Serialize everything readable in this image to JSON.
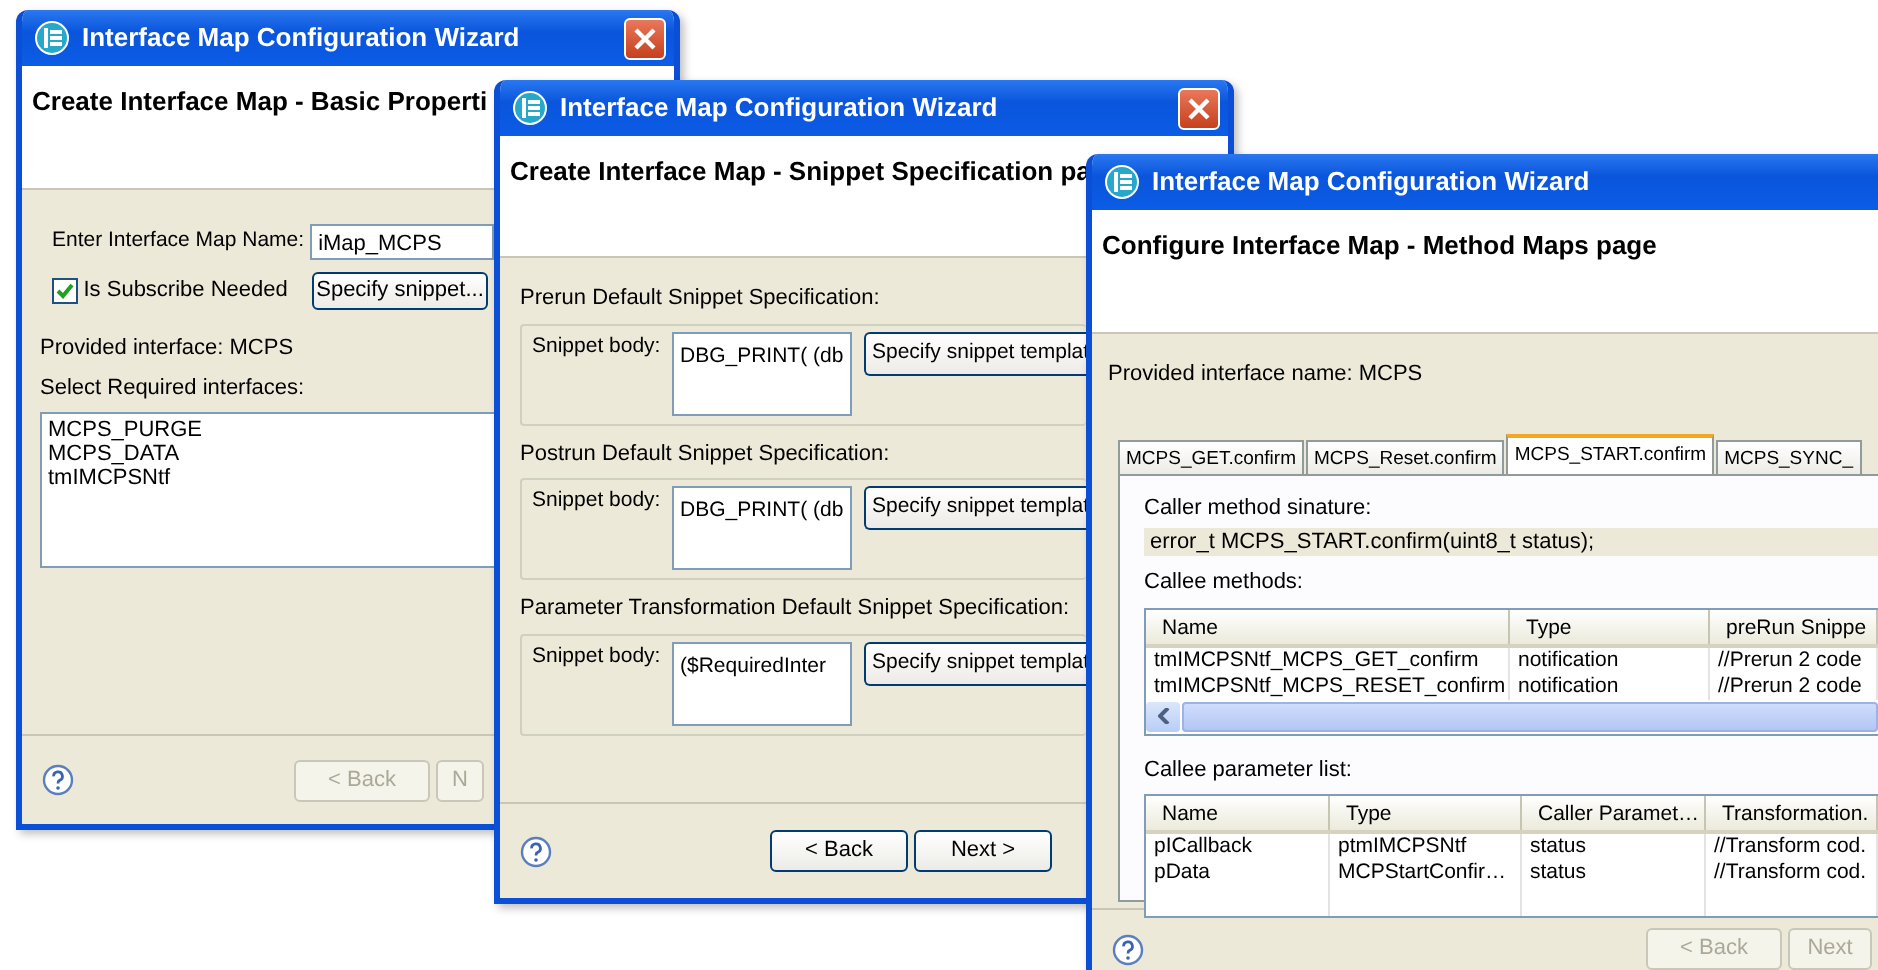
{
  "windows": [
    {
      "kind": "basic",
      "title": "Interface Map Configuration Wizard",
      "heading": "Create Interface Map - Basic Properti",
      "name_label": "Enter Interface Map Name:",
      "name_value": "iMap_MCPS",
      "subscribe": {
        "label": "Is Subscribe Needed",
        "checked": true
      },
      "snippet_button": "Specify snippet...",
      "provided": "Provided interface: MCPS",
      "select_label": "Select Required interfaces:",
      "interfaces": [
        "MCPS_PURGE",
        "MCPS_DATA",
        "tmIMCPSNtf"
      ],
      "buttons": [
        {
          "label": "< Back",
          "disabled": true
        },
        {
          "label": "N",
          "disabled": true
        }
      ]
    },
    {
      "kind": "snippet",
      "title": "Interface Map Configuration Wizard",
      "heading": "Create Interface Map - Snippet Specification pa",
      "groups": [
        {
          "label": "Prerun Default Snippet Specification:",
          "body_label": "Snippet body:",
          "body": "DBG_PRINT( (db",
          "button": "Specify snippet templat"
        },
        {
          "label": "Postrun Default Snippet Specification:",
          "body_label": "Snippet body:",
          "body": "DBG_PRINT( (db",
          "button": "Specify snippet templat"
        },
        {
          "label": "Parameter Transformation Default Snippet Specification:",
          "body_label": "Snippet body:",
          "body": "($RequiredInter",
          "button": "Specify snippet templat"
        }
      ],
      "buttons": [
        {
          "label": "< Back",
          "disabled": false
        },
        {
          "label": "Next >",
          "disabled": false
        }
      ]
    },
    {
      "kind": "methods",
      "title": "Interface Map Configuration Wizard",
      "heading": "Configure Interface Map - Method Maps page",
      "provided": "Provided interface name: MCPS",
      "tabs": [
        {
          "label": "MCPS_GET.confirm",
          "selected": false
        },
        {
          "label": "MCPS_Reset.confirm",
          "selected": false
        },
        {
          "label": "MCPS_START.confirm",
          "selected": true
        },
        {
          "label": "MCPS_SYNC_",
          "selected": false
        }
      ],
      "caller_label": "Caller method sinature:",
      "signature": "error_t MCPS_START.confirm(uint8_t status);",
      "callee_label": "Callee methods:",
      "callee_table": {
        "columns": [
          "Name",
          "Type",
          "preRun Snippe"
        ],
        "rows": [
          [
            "tmIMCPSNtf_MCPS_GET_confirm",
            "notification",
            "//Prerun 2 code"
          ],
          [
            "tmIMCPSNtf_MCPS_RESET_confirm",
            "notification",
            "//Prerun 2 code"
          ]
        ]
      },
      "param_label": "Callee parameter list:",
      "param_table": {
        "columns": [
          "Name",
          "Type",
          "Caller Paramet…",
          "Transformation."
        ],
        "rows": [
          [
            "pICallback",
            "ptmIMCPSNtf",
            "status",
            "//Transform cod."
          ],
          [
            "pData",
            "MCPStartConfir…",
            "status",
            "//Transform cod."
          ]
        ]
      },
      "buttons": [
        {
          "label": "< Back",
          "disabled": true
        },
        {
          "label": "Next",
          "disabled": true
        }
      ]
    }
  ]
}
